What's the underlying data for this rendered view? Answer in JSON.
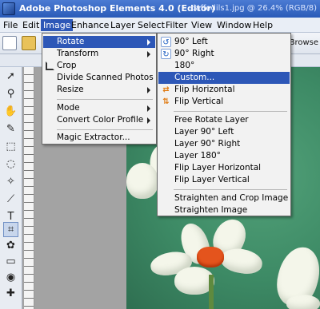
{
  "window": {
    "app_title": "Adobe Photoshop Elements 4.0 (Editor)",
    "doc_title": "daffodils1.jpg @ 26.4% (RGB/8)"
  },
  "menubar": [
    "File",
    "Edit",
    "Image",
    "Enhance",
    "Layer",
    "Select",
    "Filter",
    "View",
    "Window",
    "Help"
  ],
  "toolbar": {
    "browse_label": "Photo Browse"
  },
  "image_menu": {
    "rotate": "Rotate",
    "transform": "Transform",
    "crop": "Crop",
    "divide": "Divide Scanned Photos",
    "resize": "Resize",
    "mode": "Mode",
    "color_profile": "Convert Color Profile",
    "magic_extractor": "Magic Extractor..."
  },
  "rotate_menu": {
    "left90": "90° Left",
    "right90": "90° Right",
    "r180": "180°",
    "custom": "Custom...",
    "flip_h": "Flip Horizontal",
    "flip_v": "Flip Vertical",
    "free_rotate": "Free Rotate Layer",
    "layer_left90": "Layer 90° Left",
    "layer_right90": "Layer 90° Right",
    "layer_180": "Layer 180°",
    "flip_layer_h": "Flip Layer Horizontal",
    "flip_layer_v": "Flip Layer Vertical",
    "straighten_crop": "Straighten and Crop Image",
    "straighten": "Straighten Image"
  },
  "colors": {
    "highlight": "#2d57b7",
    "canvas_green": "#3d8a65",
    "flower_cup": "#e4541d"
  }
}
